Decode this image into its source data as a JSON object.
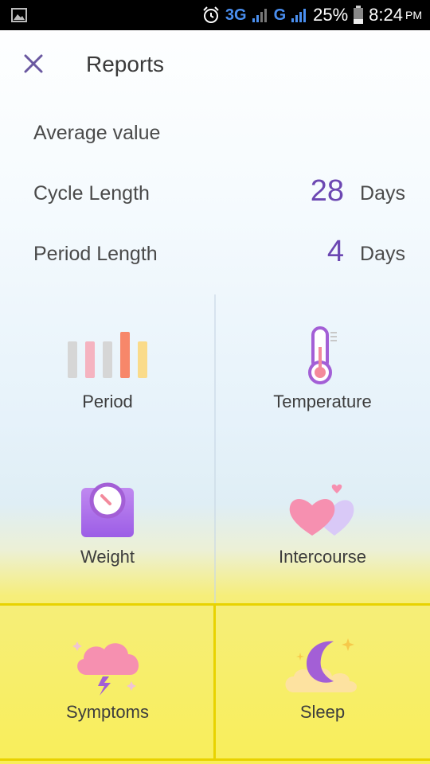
{
  "status_bar": {
    "network_3g": "3G",
    "network_g": "G",
    "battery": "25%",
    "time": "8:24",
    "ampm": "PM"
  },
  "header": {
    "title": "Reports"
  },
  "average": {
    "heading": "Average value",
    "rows": [
      {
        "label": "Cycle Length",
        "value": "28",
        "unit": "Days"
      },
      {
        "label": "Period Length",
        "value": "4",
        "unit": "Days"
      }
    ]
  },
  "categories": [
    {
      "label": "Period",
      "icon": "bar-chart-icon"
    },
    {
      "label": "Temperature",
      "icon": "thermometer-icon"
    },
    {
      "label": "Weight",
      "icon": "scale-icon"
    },
    {
      "label": "Intercourse",
      "icon": "hearts-icon"
    },
    {
      "label": "Symptoms",
      "icon": "storm-cloud-icon"
    },
    {
      "label": "Sleep",
      "icon": "moon-cloud-icon"
    }
  ],
  "colors": {
    "accent": "#6c47b2",
    "value": "#6c47b2"
  }
}
